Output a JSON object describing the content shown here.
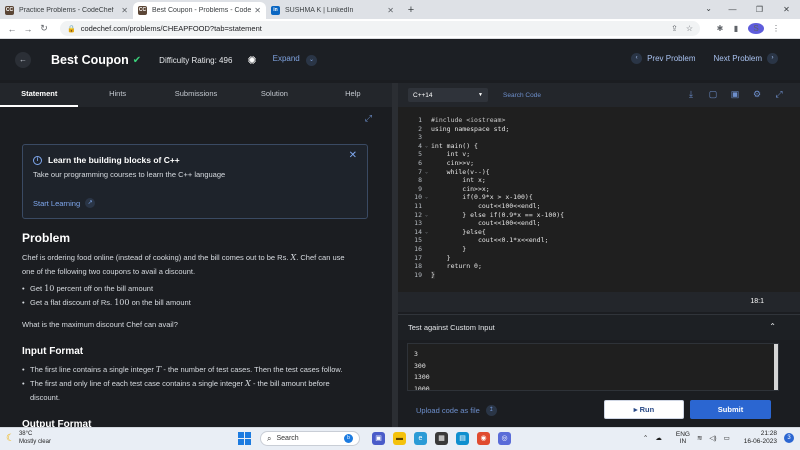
{
  "browser": {
    "tabs": [
      {
        "label": "Practice Problems - CodeChef",
        "favicon": "CC",
        "active": false
      },
      {
        "label": "Best Coupon - Problems - CodeChef",
        "favicon": "CC",
        "active": true
      },
      {
        "label": "SUSHMA K | LinkedIn",
        "favicon": "in",
        "active": false
      }
    ],
    "url": "codechef.com/problems/CHEAPFOOD?tab=statement",
    "profile_initial": "S"
  },
  "header": {
    "title": "Best Coupon",
    "difficulty": "Difficulty Rating: 496",
    "expand_label": "Expand",
    "prev_label": "Prev Problem",
    "next_label": "Next Problem"
  },
  "left_tabs": [
    "Statement",
    "Hints",
    "Submissions",
    "Solution",
    "Help"
  ],
  "learn_box": {
    "title": "Learn the building blocks of C++",
    "text": "Take our programming courses to learn the C++ language",
    "link": "Start Learning"
  },
  "statement": {
    "heading": "Problem",
    "intro_1": "Chef is ordering food online (instead of cooking) and the bill comes out to be Rs.",
    "intro_var": "X",
    "intro_2": ". Chef can use",
    "intro_3": "one of the following two coupons to avail a discount.",
    "bullet1_a": "Get",
    "bullet1_num": "10",
    "bullet1_b": "percent off on the bill amount",
    "bullet2_a": "Get a flat discount of Rs.",
    "bullet2_num": "100",
    "bullet2_b": "on the bill amount",
    "question": "What is the maximum discount Chef can avail?",
    "input_heading": "Input Format",
    "input_b1_a": "The first line contains a single integer",
    "input_b1_var": "T",
    "input_b1_b": "- the number of test cases. Then the test cases follow.",
    "input_b2_a": "The first and only line of each test case contains a single integer",
    "input_b2_var": "X",
    "input_b2_b": "- the bill amount before",
    "input_b2_c": "discount.",
    "output_heading": "Output Format"
  },
  "editor": {
    "language": "C++14",
    "search_label": "Search Code",
    "lines": [
      "#include <iostream>",
      "using namespace std;",
      "",
      "int main() {",
      "    int v;",
      "    cin>>v;",
      "    while(v--){",
      "        int x;",
      "        cin>>x;",
      "        if(0.9*x > x-100){",
      "            cout<<100<<endl;",
      "        } else if(0.9*x == x-100){",
      "            cout<<100<<endl;",
      "        }else{",
      "            cout<<0.1*x<<endl;",
      "        }",
      "    }",
      "    return 0;",
      "}"
    ],
    "cursor": "18:1"
  },
  "custom_input": {
    "label": "Test against Custom Input",
    "lines": [
      "3",
      "300",
      "1300",
      "1000"
    ]
  },
  "actions": {
    "upload": "Upload code as file",
    "run": "Run",
    "submit": "Submit"
  },
  "taskbar": {
    "temperature": "38°C",
    "weather": "Mostly clear",
    "search": "Search",
    "lang1": "ENG",
    "lang2": "IN",
    "time": "21:28",
    "date": "16-06-2023",
    "notifications": "3"
  },
  "colors": {
    "accent_blue": "#2b66d1",
    "link_blue": "#7fa8ef",
    "check_green": "#3ad07a"
  }
}
